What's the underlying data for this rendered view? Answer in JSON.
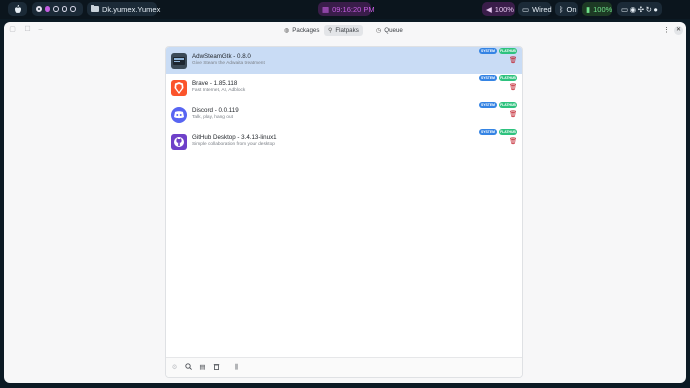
{
  "topbar": {
    "distro_icon": "apple-logo-icon",
    "window_title": "Dk.yumex.Yumex",
    "window_icon": "folder-icon",
    "clock": "09:16:20 PM",
    "volume": "100%",
    "network": "Wired",
    "bluetooth": "On",
    "battery": "100%",
    "tray_icons": [
      "screen-icon",
      "discord-icon",
      "controller-icon",
      "refresh-icon",
      "steam-icon"
    ]
  },
  "header": {
    "tabs": [
      {
        "label": "Packages",
        "icon": "package-icon"
      },
      {
        "label": "Flatpaks",
        "icon": "pin-icon"
      },
      {
        "label": "Queue",
        "icon": "clock-icon"
      }
    ],
    "active_tab": "Flatpaks"
  },
  "flatpaks": [
    {
      "name": "AdwSteamGtk - 0.8.0",
      "description": "Give Steam the Adwaita treatment",
      "badges": [
        "SYSTEM",
        "FLATHUB"
      ],
      "selected": true
    },
    {
      "name": "Brave - 1.85.118",
      "description": "Fast Internet, AI, Adblock",
      "badges": [
        "SYSTEM",
        "FLATHUB"
      ],
      "selected": false
    },
    {
      "name": "Discord - 0.0.119",
      "description": "Talk, play, hang out",
      "badges": [
        "SYSTEM",
        "FLATHUB"
      ],
      "selected": false
    },
    {
      "name": "GitHub Desktop - 3.4.13-linux1",
      "description": "Simple collaboration from your desktop",
      "badges": [
        "SYSTEM",
        "FLATHUB"
      ],
      "selected": false
    }
  ],
  "colors": {
    "selected_row": "#c9dcf5",
    "system_badge": "#3584e4",
    "flathub_badge": "#2ec27e",
    "remove_icon": "#c01c28",
    "clock_accent": "#c45ee0"
  }
}
